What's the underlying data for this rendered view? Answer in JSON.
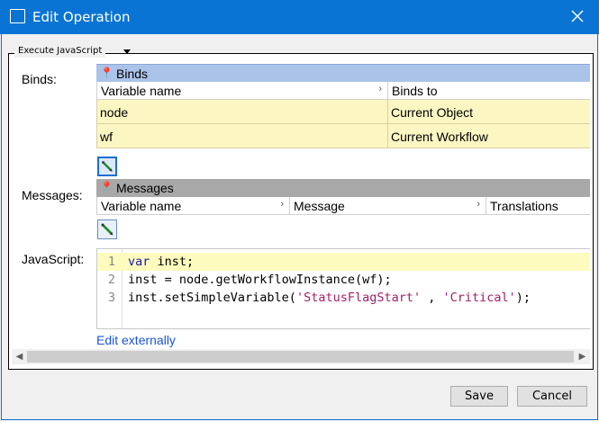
{
  "window": {
    "title": "Edit Operation"
  },
  "operation": {
    "type_label": "Execute JavaScript"
  },
  "binds": {
    "label": "Binds:",
    "header": "Binds",
    "columns": [
      "Variable name",
      "Binds to"
    ],
    "rows": [
      {
        "variable": "node",
        "binds_to": "Current Object"
      },
      {
        "variable": "wf",
        "binds_to": "Current Workflow"
      }
    ]
  },
  "messages": {
    "label": "Messages:",
    "header": "Messages",
    "columns": [
      "Variable name",
      "Message",
      "Translations"
    ]
  },
  "javascript": {
    "label": "JavaScript:",
    "line_numbers": [
      "1",
      "2",
      "3"
    ],
    "lines": {
      "l1_kw": "var",
      "l1_rest": " inst;",
      "l2_a": "inst = node.getWorkflowInstance(wf);",
      "l3_a": "inst.setSimpleVariable(",
      "l3_s1": "'StatusFlagStart'",
      "l3_b": " , ",
      "l3_s2": "'Critical'",
      "l3_c": ");"
    },
    "edit_externally": "Edit externally"
  },
  "buttons": {
    "save": "Save",
    "cancel": "Cancel"
  },
  "colors": {
    "titlebar": "#0a74d4",
    "binds_header": "#abc3e8",
    "row_highlight": "#fbf6c2",
    "link": "#1a55d8"
  }
}
